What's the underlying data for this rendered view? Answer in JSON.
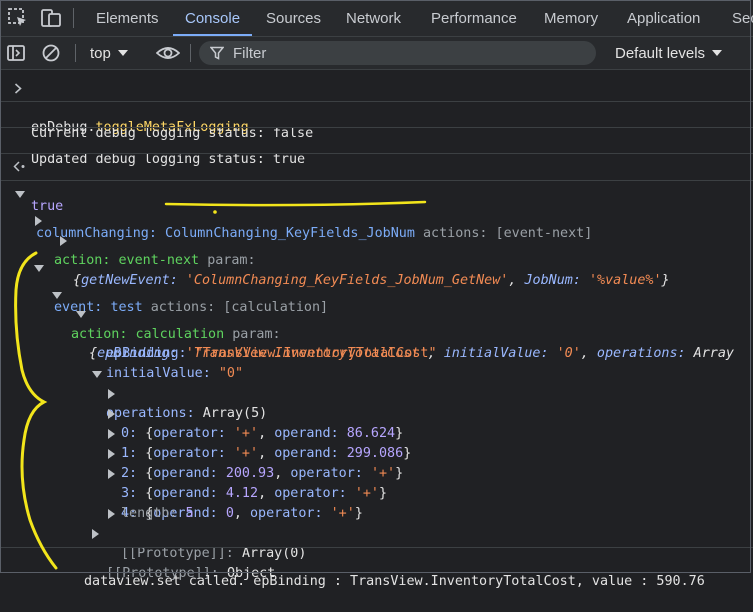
{
  "tabs": {
    "elements": "Elements",
    "console": "Console",
    "sources": "Sources",
    "network": "Network",
    "performance": "Performance",
    "memory": "Memory",
    "application": "Application",
    "security_partial": "Sec"
  },
  "toolbar": {
    "context": "top",
    "filter_placeholder": "Filter",
    "levels": "Default levels"
  },
  "console": {
    "input_obj": "epDebug.",
    "input_fn": "toggleMetaFxLogging",
    "log1": "Current debug logging status: false",
    "log2": "Updated debug logging status: true",
    "result": "true",
    "col_key": "columnChanging:",
    "col_val": "ColumnChanging_KeyFields_JobNum",
    "col_actions": "actions: [event-next]",
    "a1_key": "action: event-next",
    "a1_param": "param:",
    "a1_obj_open": "{",
    "a1_k1": "getNewEvent:",
    "a1_v1": "'ColumnChanging_KeyFields_JobNum_GetNew'",
    "a1_k2": "JobNum:",
    "a1_v2": "'%value%'",
    "a1_obj_close": "}",
    "ev_key": "event:",
    "ev_name": "test",
    "ev_actions": "actions: [calculation]",
    "a2_key": "action: calculation",
    "a2_param": "param:",
    "sum_k1": "epBinding:",
    "sum_v1": "'TransView.InventoryTotalCost'",
    "sum_k2": "initialValue:",
    "sum_v2": "'0'",
    "sum_k3": "operations:",
    "sum_v3": "Array",
    "ep_k": "epBinding:",
    "ep_v": "\"TransView.InventoryTotalCost\"",
    "iv_k": "initialValue:",
    "iv_v": "\"0\"",
    "ops_k": "operations:",
    "ops_v": "Array(5)",
    "op0": {
      "idx": "0:",
      "k1": "operator:",
      "v1": "'+'",
      "k2": "operand:",
      "v2": "86.624"
    },
    "op1": {
      "idx": "1:",
      "k1": "operator:",
      "v1": "'+'",
      "k2": "operand:",
      "v2": "299.086"
    },
    "op2": {
      "idx": "2:",
      "k1": "operand:",
      "v1": "200.93",
      "k2": "operator:",
      "v2": "'+'"
    },
    "op3": {
      "idx": "3:",
      "k1": "operand:",
      "v1": "4.12",
      "k2": "operator:",
      "v2": "'+'"
    },
    "op4": {
      "idx": "4:",
      "k1": "operand:",
      "v1": "0",
      "k2": "operator:",
      "v2": "'+'"
    },
    "len_k": "length:",
    "len_v": "5",
    "proto1_k": "[[Prototype]]:",
    "proto1_v": "Array(0)",
    "proto2_k": "[[Prototype]]:",
    "proto2_v": "Object",
    "last_log": "dataview.set called. epBinding : TransView.InventoryTotalCost, value : 590.76"
  },
  "colors": {
    "annotation": "#f2e51b",
    "accent": "#7cacf8"
  }
}
